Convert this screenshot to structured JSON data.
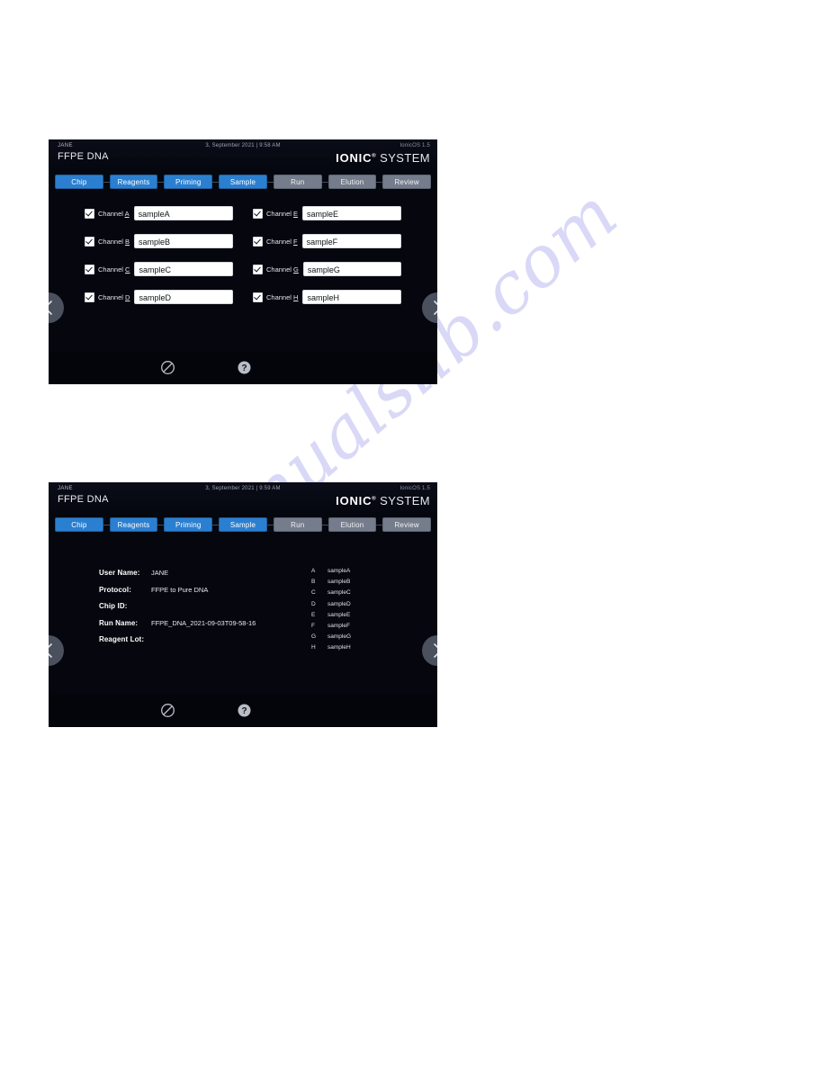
{
  "watermark": {
    "text": "manualslib.com"
  },
  "screens": [
    {
      "id": "sample",
      "header": {
        "user": "JANE",
        "datetime": "3, September 2021 | 9:58 AM",
        "version": "IonicOS 1.5",
        "protocol": "FFPE DNA",
        "brand_bold": "IONIC",
        "brand_reg": "®",
        "brand_light": " SYSTEM"
      },
      "steps": [
        {
          "label": "Chip",
          "state": "done"
        },
        {
          "label": "Reagents",
          "state": "done"
        },
        {
          "label": "Priming",
          "state": "done"
        },
        {
          "label": "Sample",
          "state": "done"
        },
        {
          "label": "Run",
          "state": "todo"
        },
        {
          "label": "Elution",
          "state": "todo"
        },
        {
          "label": "Review",
          "state": "todo"
        }
      ],
      "channels": [
        {
          "prefix": "Channel ",
          "key": "A",
          "value": "sampleA",
          "checked": true
        },
        {
          "prefix": "Channel ",
          "key": "E",
          "value": "sampleE",
          "checked": true
        },
        {
          "prefix": "Channel ",
          "key": "B",
          "value": "sampleB",
          "checked": true
        },
        {
          "prefix": "Channel ",
          "key": "F",
          "value": "sampleF",
          "checked": true
        },
        {
          "prefix": "Channel ",
          "key": "C",
          "value": "sampleC",
          "checked": true
        },
        {
          "prefix": "Channel ",
          "key": "G",
          "value": "sampleG",
          "checked": true
        },
        {
          "prefix": "Channel ",
          "key": "D",
          "value": "sampleD",
          "checked": true
        },
        {
          "prefix": "Channel ",
          "key": "H",
          "value": "sampleH",
          "checked": true
        }
      ],
      "nav": {
        "prev_icon": "chevron-left-icon",
        "next_icon": "chevron-right-icon"
      },
      "footer": {
        "cancel_icon": "prohibited-icon",
        "help_icon": "help-circle-icon"
      }
    },
    {
      "id": "review",
      "header": {
        "user": "JANE",
        "datetime": "3, September 2021 | 9:59 AM",
        "version": "IonicOS 1.5",
        "protocol": "FFPE DNA",
        "brand_bold": "IONIC",
        "brand_reg": "®",
        "brand_light": " SYSTEM"
      },
      "steps": [
        {
          "label": "Chip",
          "state": "done"
        },
        {
          "label": "Reagents",
          "state": "done"
        },
        {
          "label": "Priming",
          "state": "done"
        },
        {
          "label": "Sample",
          "state": "done"
        },
        {
          "label": "Run",
          "state": "todo"
        },
        {
          "label": "Elution",
          "state": "todo"
        },
        {
          "label": "Review",
          "state": "todo"
        }
      ],
      "summary": [
        {
          "key": "User Name:",
          "value": "JANE"
        },
        {
          "key": "Protocol:",
          "value": "FFPE to Pure DNA"
        },
        {
          "key": "Chip ID:",
          "value": ""
        },
        {
          "key": "Run Name:",
          "value": "FFPE_DNA_2021-09-03T09-58-16"
        },
        {
          "key": "Reagent Lot:",
          "value": ""
        }
      ],
      "samples": [
        {
          "channel": "A",
          "name": "sampleA"
        },
        {
          "channel": "B",
          "name": "sampleB"
        },
        {
          "channel": "C",
          "name": "sampleC"
        },
        {
          "channel": "D",
          "name": "sampleD"
        },
        {
          "channel": "E",
          "name": "sampleE"
        },
        {
          "channel": "F",
          "name": "sampleF"
        },
        {
          "channel": "G",
          "name": "sampleG"
        },
        {
          "channel": "H",
          "name": "sampleH"
        }
      ],
      "nav": {
        "prev_icon": "chevron-left-icon",
        "next_icon": "chevron-right-icon"
      },
      "footer": {
        "cancel_icon": "prohibited-icon",
        "help_icon": "help-circle-icon"
      }
    }
  ]
}
